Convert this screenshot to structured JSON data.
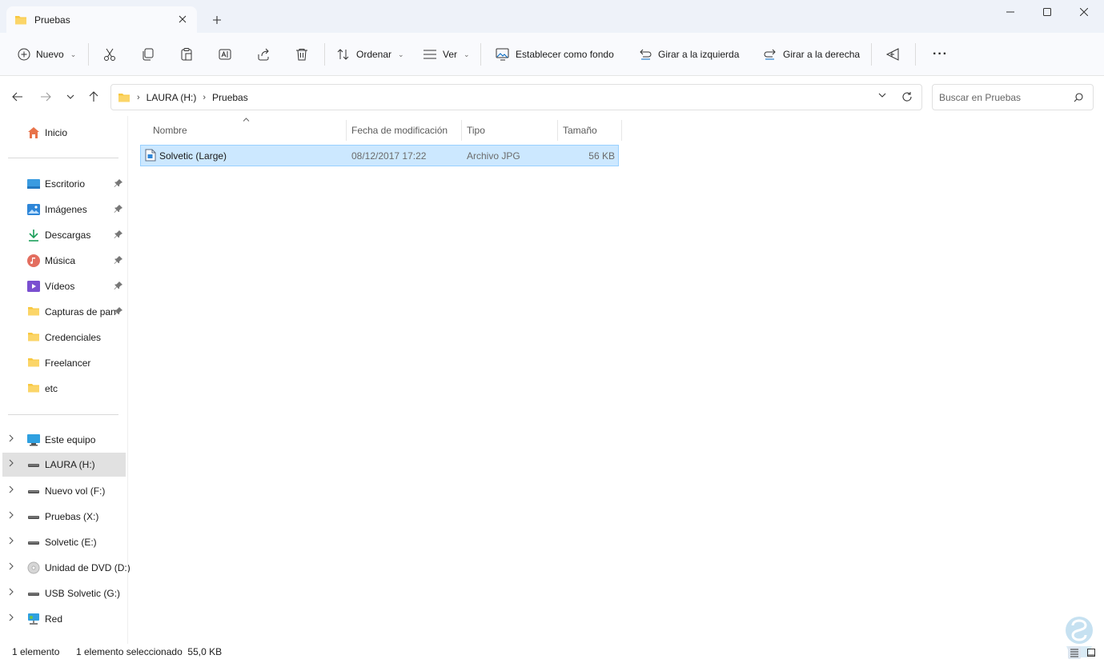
{
  "window": {
    "tab_title": "Pruebas",
    "new_tab_label": "+"
  },
  "toolbar": {
    "new_label": "Nuevo",
    "sort_label": "Ordenar",
    "view_label": "Ver",
    "set_background_label": "Establecer como fondo",
    "rotate_left_label": "Girar a la izquierda",
    "rotate_right_label": "Girar a la derecha",
    "more_label": "···"
  },
  "address": {
    "breadcrumbs": [
      "LAURA (H:)",
      "Pruebas"
    ]
  },
  "search": {
    "placeholder": "Buscar en Pruebas"
  },
  "sidebar": {
    "home": "Inicio",
    "quick_access": [
      {
        "label": "Escritorio",
        "icon": "desktop-icon"
      },
      {
        "label": "Imágenes",
        "icon": "pictures-icon"
      },
      {
        "label": "Descargas",
        "icon": "downloads-icon"
      },
      {
        "label": "Música",
        "icon": "music-icon"
      },
      {
        "label": "Vídeos",
        "icon": "videos-icon"
      },
      {
        "label": "Capturas de pan",
        "icon": "folder-icon"
      },
      {
        "label": "Credenciales",
        "icon": "folder-icon"
      },
      {
        "label": "Freelancer",
        "icon": "folder-icon"
      },
      {
        "label": "etc",
        "icon": "folder-icon"
      }
    ],
    "drives": [
      {
        "label": "Este equipo",
        "icon": "computer-icon"
      },
      {
        "label": "LAURA (H:)",
        "icon": "drive-icon"
      },
      {
        "label": "Nuevo vol (F:)",
        "icon": "drive-icon"
      },
      {
        "label": "Pruebas (X:)",
        "icon": "drive-icon"
      },
      {
        "label": "Solvetic (E:)",
        "icon": "drive-icon"
      },
      {
        "label": "Unidad de DVD (D:)",
        "icon": "dvd-icon"
      },
      {
        "label": "USB Solvetic (G:)",
        "icon": "drive-icon"
      },
      {
        "label": "Red",
        "icon": "network-icon"
      }
    ]
  },
  "columns": {
    "name": "Nombre",
    "modified": "Fecha de modificación",
    "type": "Tipo",
    "size": "Tamaño"
  },
  "files": [
    {
      "name": "Solvetic (Large)",
      "modified": "08/12/2017 17:22",
      "type": "Archivo JPG",
      "size": "56 KB"
    }
  ],
  "status": {
    "count": "1 elemento",
    "selection": "1 elemento seleccionado  55,0 KB"
  },
  "colors": {
    "selection_bg": "#cce8ff",
    "selection_border": "#99d1ff",
    "folder": "#f8c840",
    "accent": "#0067c0"
  }
}
